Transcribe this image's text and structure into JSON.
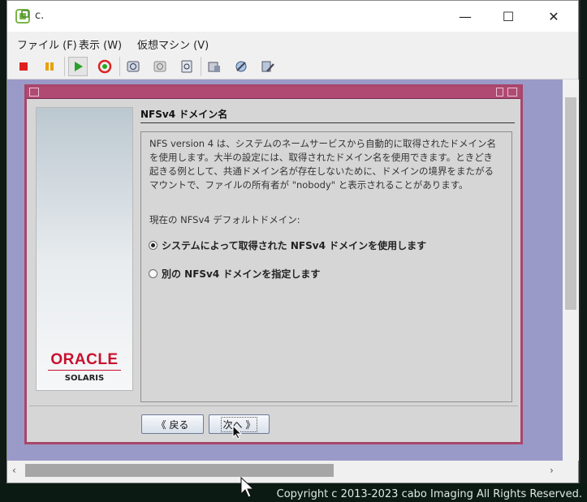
{
  "window": {
    "title": "c.",
    "minimize": "—",
    "maximize": "☐",
    "close": "✕"
  },
  "menubar": {
    "items": [
      "ファイル (F)",
      "表示 (W)",
      "仮想マシン (V)"
    ]
  },
  "toolbar": {
    "buttons": [
      "stop-icon",
      "pause-icon",
      "play-icon",
      "reset-icon",
      "snapshot-icon",
      "snapshot-revert-icon",
      "snapshot-manager-icon",
      "settings-icon",
      "tools-icon",
      "wrench-icon"
    ]
  },
  "dialog": {
    "title": "NFSv4 ドメイン名",
    "description": "NFS version 4 は、システムのネームサービスから自動的に取得されたドメイン名を使用します。大半の設定には、取得されたドメイン名を使用できます。ときどき起きる例として、共通ドメイン名が存在しないために、ドメインの境界をまたがるマウントで、ファイルの所有者が \"nobody\" と表示されることがあります。",
    "current_label": "現在の NFSv4 デフォルトドメイン:",
    "option_auto": "システムによって取得された NFSv4 ドメインを使用します",
    "option_manual": "別の NFSv4 ドメインを指定します",
    "selected": "option_auto",
    "back_label": "《 戻る",
    "next_label": "次へ 》",
    "brand": "ORACLE",
    "brand_sub": "SOLARIS"
  },
  "desktop": {
    "copyright": "Copyright c 2013-2023 cabo Imaging All Rights Reserved."
  },
  "colors": {
    "accent": "#b04a72",
    "vm_background": "#9a9ac8",
    "oracle_red": "#c8102e"
  }
}
